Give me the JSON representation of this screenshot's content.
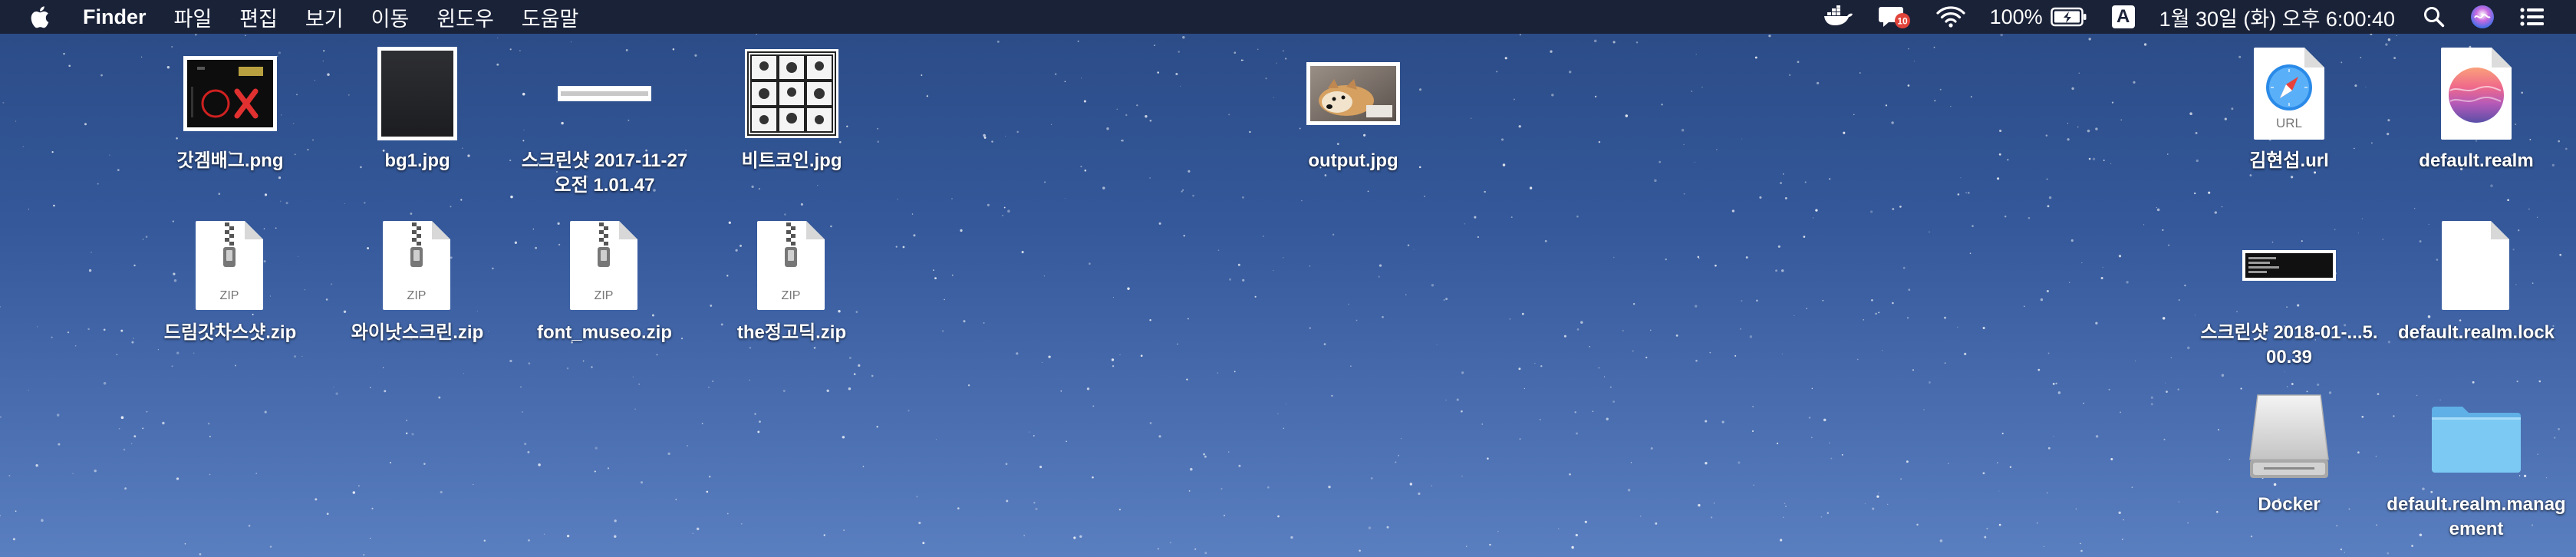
{
  "menubar": {
    "app_name": "Finder",
    "menus": [
      "파일",
      "편집",
      "보기",
      "이동",
      "윈도우",
      "도움말"
    ],
    "tray": {
      "docker_icon": "docker-whale-icon",
      "notification_badge": "10",
      "wifi_icon": "wifi-icon",
      "battery_percent": "100%",
      "battery_icon": "battery-charging-icon",
      "input_source": "A",
      "clock": "1월 30일 (화) 오후 6:00:40",
      "search_icon": "spotlight-search-icon",
      "siri_icon": "siri-icon",
      "notification_center_icon": "notification-list-icon"
    }
  },
  "desktop": {
    "icons": [
      {
        "label": "갓겜배그.png",
        "kind": "image-game-screenshot"
      },
      {
        "label": "bg1.jpg",
        "kind": "image-dark"
      },
      {
        "label": "스크린샷 2017-11-27 오전 1.01.47",
        "kind": "image-screenshot-thin"
      },
      {
        "label": "비트코인.jpg",
        "kind": "image-comic"
      },
      {
        "label": "output.jpg",
        "kind": "image-dog"
      },
      {
        "label": "김현섭.url",
        "kind": "url-file"
      },
      {
        "label": "default.realm",
        "kind": "realm-file"
      },
      {
        "label": "드림갓차스샷.zip",
        "kind": "zip-file"
      },
      {
        "label": "와이낫스크린.zip",
        "kind": "zip-file"
      },
      {
        "label": "font_museo.zip",
        "kind": "zip-file"
      },
      {
        "label": "the정고딕.zip",
        "kind": "zip-file"
      },
      {
        "label": "스크린샷 2018-01-...5.00.39",
        "kind": "image-terminal-screenshot"
      },
      {
        "label": "default.realm.lock",
        "kind": "blank-document"
      },
      {
        "label": "Docker",
        "kind": "disk-drive"
      },
      {
        "label": "default.realm.management",
        "kind": "folder"
      }
    ],
    "zip_badge": "ZIP",
    "url_badge": "URL"
  },
  "colors": {
    "menubar_bg": "#1a2238",
    "desktop_top": "#2a4a84",
    "desktop_bottom": "#5a7fc0",
    "folder_blue": "#6cc0f0",
    "badge_red": "#e0443a"
  }
}
